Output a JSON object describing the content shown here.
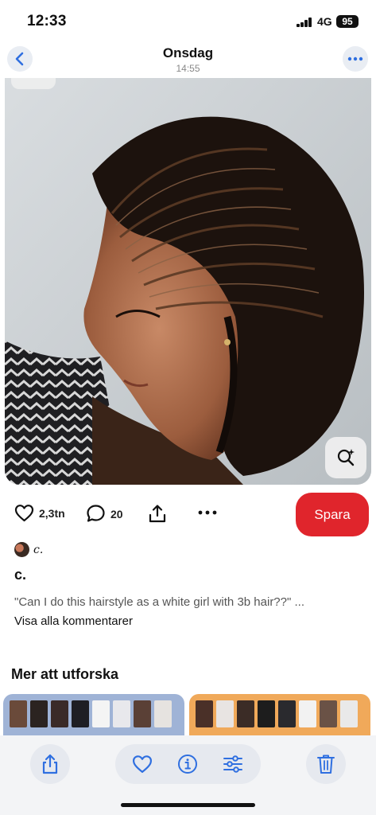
{
  "status_bar": {
    "time": "12:33",
    "network": "4G",
    "battery": "95"
  },
  "header": {
    "title": "Onsdag",
    "subtitle": "14:55"
  },
  "pin": {
    "likes": "2,3tn",
    "comments_count": "20",
    "save_label": "Spara",
    "author": "c.",
    "title": "c.",
    "comment": "\"Can I do this hairstyle as a white girl with 3b hair??\" ...",
    "view_all": "Visa alla kommentarer"
  },
  "explore": {
    "title": "Mer att utforska"
  },
  "icons": {
    "back": "chevron-left-icon",
    "more": "ellipsis-icon",
    "lens": "visual-search-icon",
    "like": "heart-icon",
    "comment": "comment-bubble-icon",
    "share": "share-icon",
    "options": "ellipsis-icon",
    "bottom_share": "share-icon",
    "bottom_like": "heart-icon",
    "bottom_info": "info-icon",
    "bottom_adjust": "sliders-icon",
    "bottom_delete": "trash-icon"
  },
  "colors": {
    "accent_blue": "#2f6fe0",
    "save_red": "#e0252c"
  }
}
